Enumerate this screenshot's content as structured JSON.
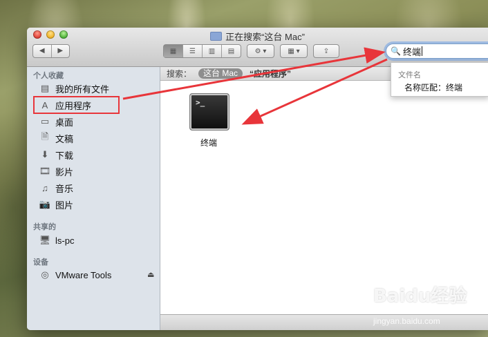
{
  "window": {
    "title": "正在搜索“这台 Mac”"
  },
  "toolbar": {
    "nav_back": "◀",
    "nav_forward": "▶",
    "view_icons": [
      "▦",
      "☰",
      "▥",
      "▤"
    ],
    "gear_label": "⚙ ▾",
    "arrange_label": "▦ ▾",
    "share_label": "⇪"
  },
  "search": {
    "value": "终端",
    "icon": "search-icon"
  },
  "sidebar": {
    "sections": [
      {
        "label": "个人收藏"
      },
      {
        "label": "共享的"
      },
      {
        "label": "设备"
      }
    ],
    "favorites": [
      {
        "label": "我的所有文件",
        "icon": "all-files-icon"
      },
      {
        "label": "应用程序",
        "icon": "applications-icon"
      },
      {
        "label": "桌面",
        "icon": "desktop-icon"
      },
      {
        "label": "文稿",
        "icon": "documents-icon"
      },
      {
        "label": "下载",
        "icon": "downloads-icon"
      },
      {
        "label": "影片",
        "icon": "movies-icon"
      },
      {
        "label": "音乐",
        "icon": "music-icon"
      },
      {
        "label": "图片",
        "icon": "pictures-icon"
      }
    ],
    "shared": [
      {
        "label": "ls-pc",
        "icon": "computer-icon"
      }
    ],
    "devices": [
      {
        "label": "VMware Tools",
        "icon": "disk-icon"
      }
    ]
  },
  "scope_bar": {
    "label": "搜索：",
    "active": "这台 Mac",
    "option": "“应用程序”"
  },
  "results": [
    {
      "label": "终端",
      "icon": "terminal-icon"
    }
  ],
  "dropdown": {
    "header": "文件名",
    "item": "名称匹配：终端"
  },
  "watermark": {
    "text": "Baidu经验",
    "url": "jingyan.baidu.com"
  },
  "colors": {
    "annotation_red": "#e8353a",
    "sidebar_bg": "#dde3ea",
    "focus_ring": "#7aa6e0"
  }
}
